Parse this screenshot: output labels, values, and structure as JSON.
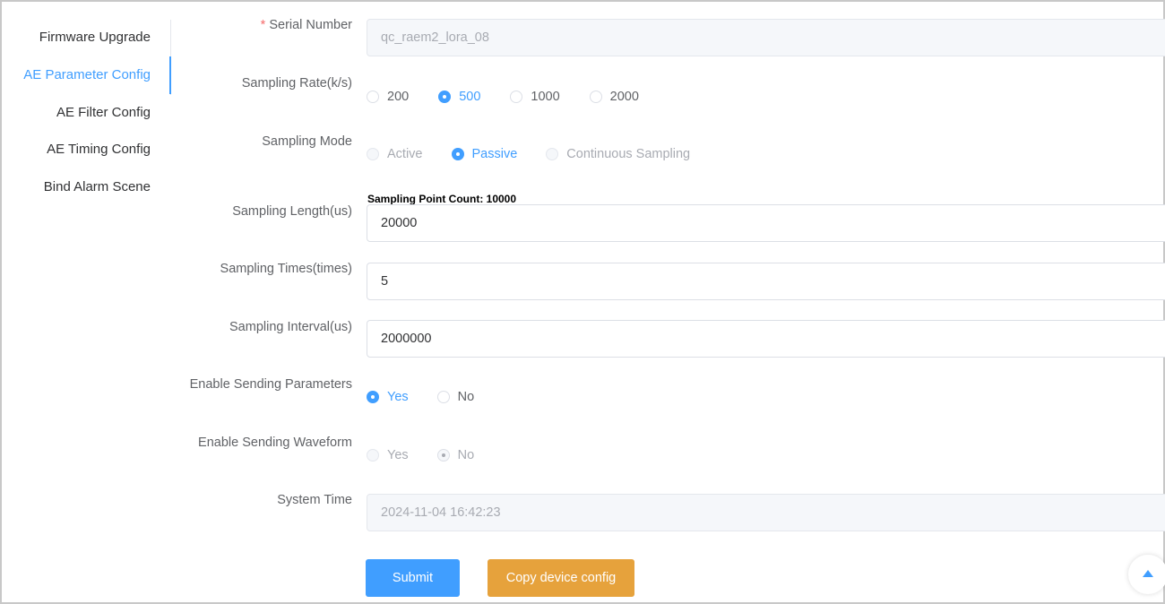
{
  "sidebar": {
    "items": [
      {
        "label": "Firmware Upgrade"
      },
      {
        "label": "AE Parameter Config"
      },
      {
        "label": "AE Filter Config"
      },
      {
        "label": "AE Timing Config"
      },
      {
        "label": "Bind Alarm Scene"
      }
    ],
    "active_index": 1
  },
  "form": {
    "serial_number": {
      "label": "Serial Number",
      "required_mark": "*",
      "value": "qc_raem2_lora_08"
    },
    "sampling_rate": {
      "label": "Sampling Rate(k/s)",
      "options": [
        "200",
        "500",
        "1000",
        "2000"
      ],
      "selected": "500"
    },
    "sampling_mode": {
      "label": "Sampling Mode",
      "options": [
        "Active",
        "Passive",
        "Continuous Sampling"
      ],
      "selected": "Passive"
    },
    "sampling_length": {
      "label": "Sampling Length(us)",
      "hint": "Sampling Point Count: 10000",
      "value": "20000"
    },
    "sampling_times": {
      "label": "Sampling Times(times)",
      "value": "5"
    },
    "sampling_interval": {
      "label": "Sampling Interval(us)",
      "value": "2000000"
    },
    "enable_sending_parameters": {
      "label": "Enable Sending Parameters",
      "options": [
        "Yes",
        "No"
      ],
      "selected": "Yes"
    },
    "enable_sending_waveform": {
      "label": "Enable Sending Waveform",
      "options": [
        "Yes",
        "No"
      ],
      "selected": "No"
    },
    "system_time": {
      "label": "System Time",
      "value": "2024-11-04 16:42:23"
    }
  },
  "buttons": {
    "submit": "Submit",
    "copy": "Copy device config"
  },
  "icons": {
    "back_to_top": "caret-up-icon"
  },
  "colors": {
    "primary": "#409eff",
    "warning": "#e6a23c",
    "required": "#f56c6c"
  }
}
